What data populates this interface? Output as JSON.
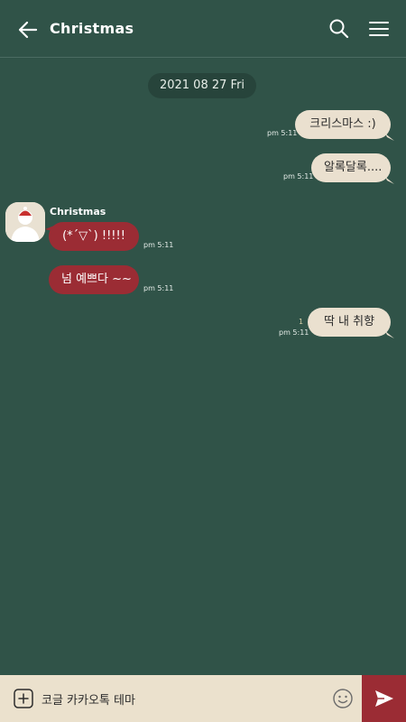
{
  "header": {
    "title": "Christmas"
  },
  "date_divider": "2021 08 27 Fri",
  "messages": [
    {
      "side": "out",
      "text": "크리스마스 :)",
      "time": "pm 5:11"
    },
    {
      "side": "out",
      "text": "알록달록....",
      "time": "pm 5:11"
    },
    {
      "side": "in",
      "sender": "Christmas",
      "text": "(*´▽`) !!!!!",
      "time": "pm 5:11"
    },
    {
      "side": "in",
      "text": "넘 예쁘다 ~~",
      "time": "pm 5:11"
    },
    {
      "side": "out",
      "text": "딱 내 취향",
      "time": "pm 5:11",
      "unread": "1"
    }
  ],
  "input": {
    "value": "코글 카카오톡 테마"
  },
  "colors": {
    "background": "#305348",
    "bubble_out": "#eae0cf",
    "bubble_in": "#9b2c34",
    "input_bar": "#ebe1cd",
    "send_button": "#9b2c34"
  },
  "icons": [
    "back-arrow-icon",
    "search-icon",
    "menu-icon",
    "plus-icon",
    "emoji-icon",
    "send-icon"
  ]
}
